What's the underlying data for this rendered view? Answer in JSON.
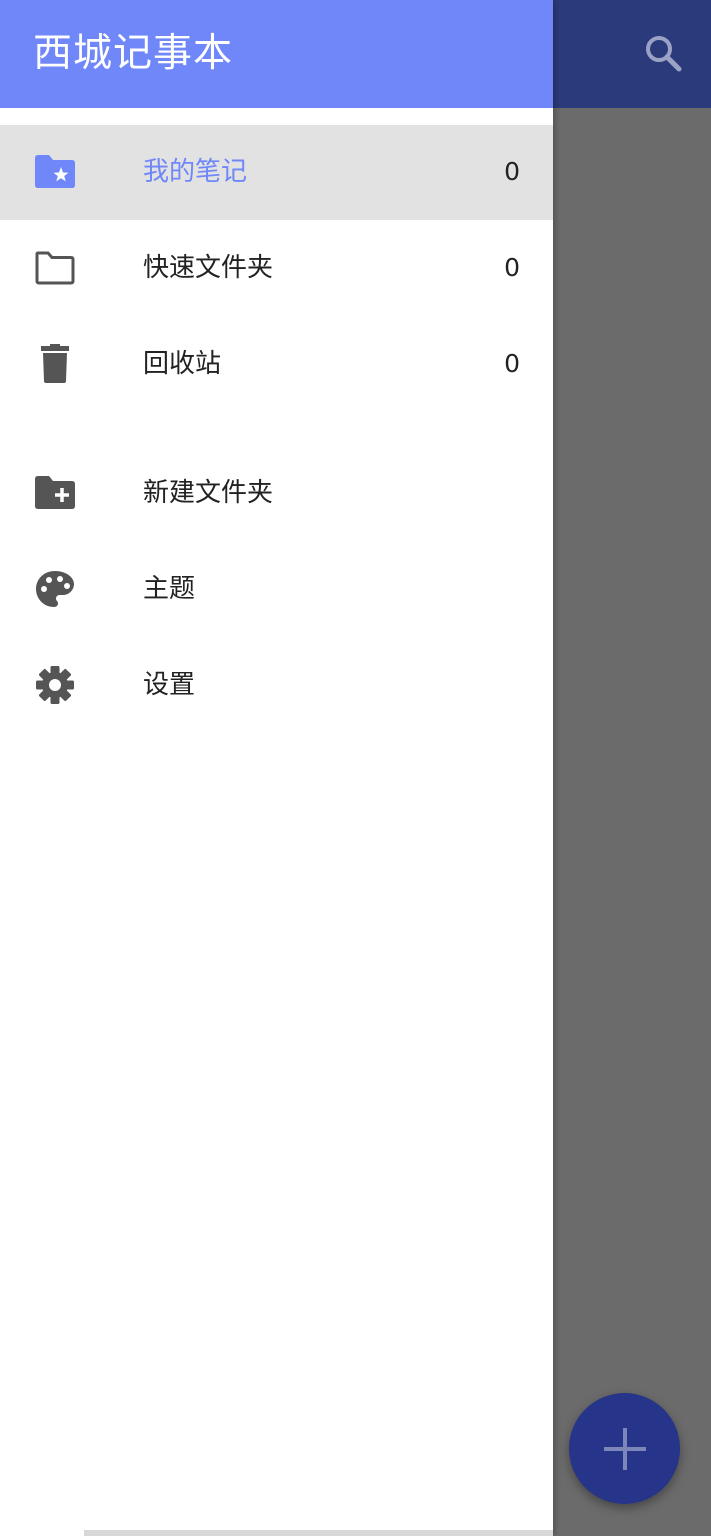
{
  "app": {
    "title": "西城记事本"
  },
  "drawer": {
    "items": [
      {
        "label": "我的笔记",
        "count": "0",
        "icon": "star-folder-icon",
        "active": true
      },
      {
        "label": "快速文件夹",
        "count": "0",
        "icon": "folder-outline-icon",
        "active": false
      },
      {
        "label": "回收站",
        "count": "0",
        "icon": "trash-icon",
        "active": false
      }
    ],
    "actions": [
      {
        "label": "新建文件夹",
        "icon": "folder-add-icon"
      },
      {
        "label": "主题",
        "icon": "palette-icon"
      },
      {
        "label": "设置",
        "icon": "gear-icon"
      }
    ]
  },
  "colors": {
    "accent": "#6f87f9",
    "fab": "#263489",
    "scrim": "#6b6b6b"
  }
}
